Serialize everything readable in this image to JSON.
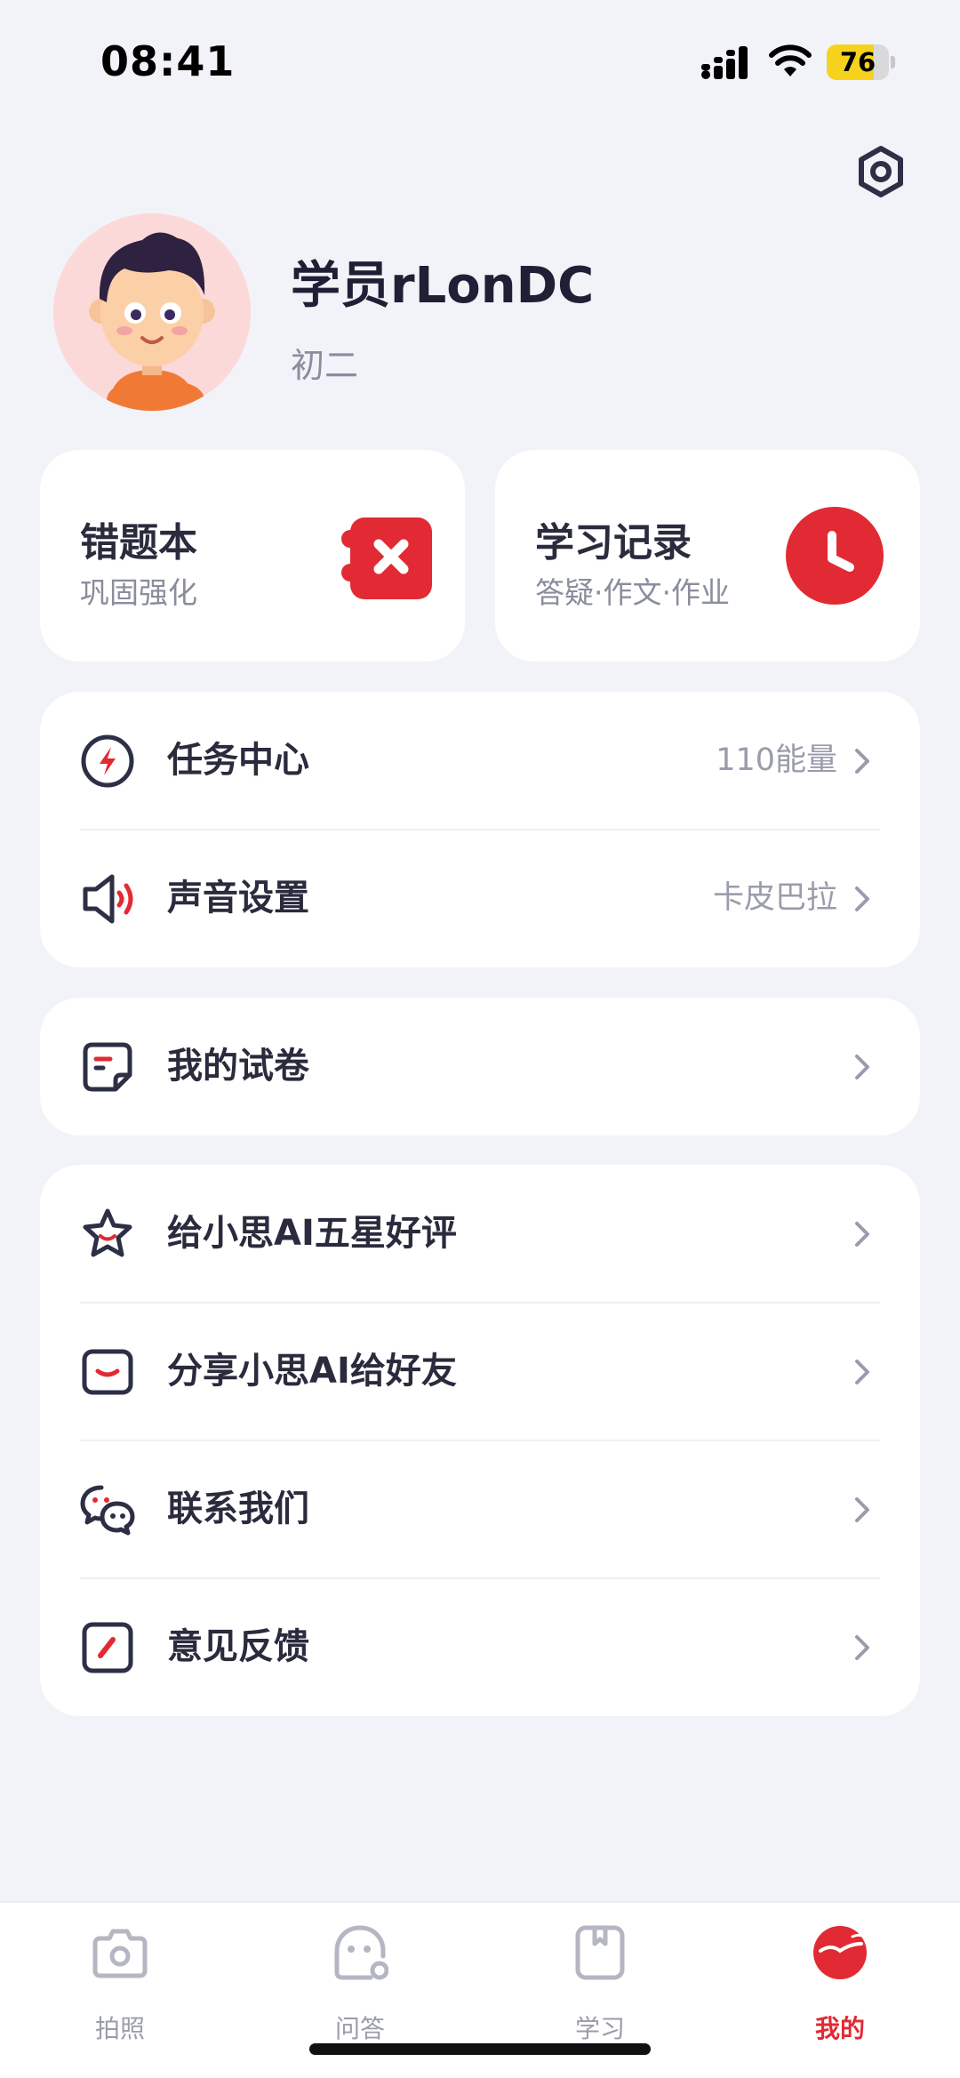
{
  "status_bar": {
    "time": "08:41",
    "battery_percent": 76,
    "battery_label": "76",
    "signal_icon": "cellular-signal-icon",
    "wifi_icon": "wifi-icon"
  },
  "header": {
    "settings_icon": "gear-icon"
  },
  "profile": {
    "name": "学员rLonDC",
    "grade": "初二",
    "avatar_icon": "cartoon-boy-avatar"
  },
  "quick_cards": [
    {
      "title": "错题本",
      "subtitle": "巩固强化",
      "icon": "wrong-book-icon"
    },
    {
      "title": "学习记录",
      "subtitle": "答疑·作文·作业",
      "icon": "clock-icon"
    }
  ],
  "groups": [
    {
      "items": [
        {
          "label": "任务中心",
          "value": "110能量",
          "icon": "lightning-icon"
        },
        {
          "label": "声音设置",
          "value": "卡皮巴拉",
          "icon": "speaker-icon"
        }
      ]
    },
    {
      "items": [
        {
          "label": "我的试卷",
          "value": "",
          "icon": "test-paper-icon"
        }
      ]
    },
    {
      "items": [
        {
          "label": "给小思AI五星好评",
          "value": "",
          "icon": "star-icon"
        },
        {
          "label": "分享小思AI给好友",
          "value": "",
          "icon": "share-icon"
        },
        {
          "label": "联系我们",
          "value": "",
          "icon": "wechat-icon"
        },
        {
          "label": "意见反馈",
          "value": "",
          "icon": "feedback-icon"
        }
      ]
    }
  ],
  "tabs": [
    {
      "label": "拍照",
      "icon": "camera-icon",
      "active": false
    },
    {
      "label": "问答",
      "icon": "chat-bubble-icon",
      "active": false
    },
    {
      "label": "学习",
      "icon": "book-icon",
      "active": false
    },
    {
      "label": "我的",
      "icon": "profile-smile-icon",
      "active": true
    }
  ],
  "colors": {
    "accent": "#e12a33",
    "background": "#f2f3f8",
    "card": "#ffffff",
    "text_primary": "#2a2b3d",
    "text_secondary": "#8a8d9c",
    "battery_fill": "#f7d21d"
  }
}
